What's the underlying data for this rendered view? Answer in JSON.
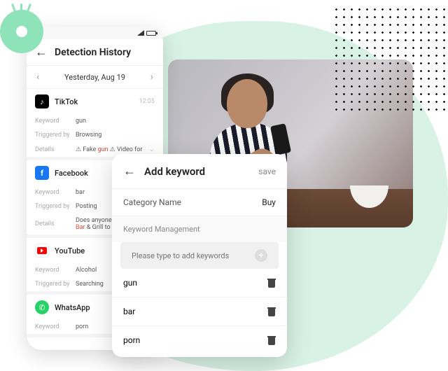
{
  "phone": {
    "title": "Detection History",
    "date": "Yesterday, Aug 19",
    "sections": [
      {
        "app": "TikTok",
        "time": "12:05",
        "keyword": "gun",
        "trigger": "Browsing",
        "details_pre": "⚠ Fake ",
        "details_hl": "gun",
        "details_post": " ⚠ Video for"
      },
      {
        "app": "Facebook",
        "time": "",
        "keyword": "bar",
        "trigger": "Posting",
        "details_pre": "Does anyone",
        "details_hl": "Bar",
        "details_post": " & Grill to"
      },
      {
        "app": "YouTube",
        "time": "",
        "keyword": "Alcohol",
        "trigger": "Searching"
      },
      {
        "app": "WhatsApp",
        "time": "",
        "keyword": "porn"
      }
    ],
    "labels": {
      "keyword": "Keyword",
      "triggered": "Triggered by",
      "details": "Details"
    }
  },
  "card": {
    "title": "Add keyword",
    "save": "save",
    "category_label": "Category Name",
    "category_value": "Buy",
    "km_header": "Keyword Management",
    "placeholder": "Please type to add keywords",
    "keywords": [
      "gun",
      "bar",
      "porn"
    ]
  }
}
